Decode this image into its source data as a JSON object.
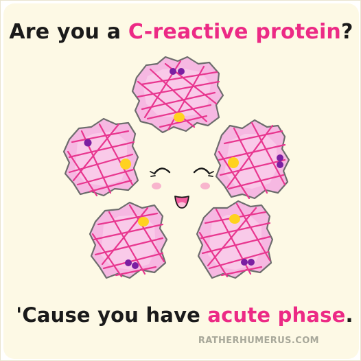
{
  "headline_top": {
    "lead": "Are you a",
    "highlight": "C-reactive protein",
    "end": "?"
  },
  "headline_bottom": {
    "lead": "'Cause you have",
    "highlight": "acute phase",
    "end": "."
  },
  "credit": "RATHERHUMERUS.COM",
  "colors": {
    "background": "#fdf9e5",
    "text_dark": "#1a1a1a",
    "accent_pink": "#ec2a85",
    "blob_fill": "#f6b8e2",
    "blob_fill_light": "#fbd6ef",
    "blob_outline": "#6d6d6d",
    "strand": "#e8368f",
    "calcium": "#ffd21f",
    "phosphocholine": "#7b1fa2",
    "cheek": "#f7a9c9",
    "mouth": "#f35da0"
  }
}
